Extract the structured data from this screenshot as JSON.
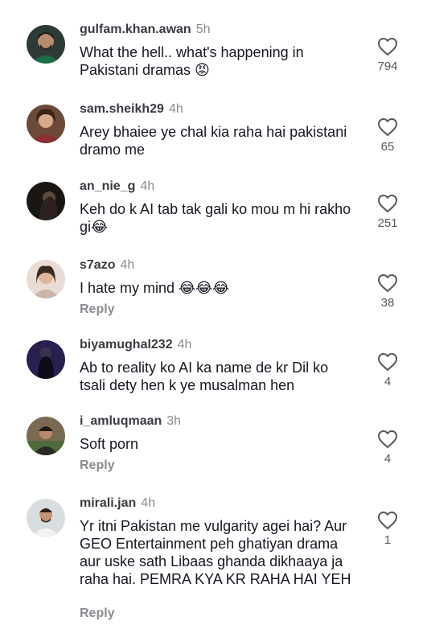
{
  "comments": [
    {
      "username": "gulfam.khan.awan",
      "time": "5h",
      "text": "What the hell.. what's happening in Pakistani dramas 😡",
      "likes": "794",
      "reply": ""
    },
    {
      "username": "sam.sheikh29",
      "time": "4h",
      "text": "Arey bhaiee ye chal kia raha hai pakistani dramo me",
      "likes": "65",
      "reply": ""
    },
    {
      "username": "an_nie_g",
      "time": "4h",
      "text": "Keh do k AI tab tak gali ko mou m hi rakho gi😂",
      "likes": "251",
      "reply": ""
    },
    {
      "username": "s7azo",
      "time": "4h",
      "text": "I hate my mind 😂😂😂",
      "likes": "38",
      "reply": "Reply"
    },
    {
      "username": "biyamughal232",
      "time": "4h",
      "text": "Ab to reality ko AI ka name  de kr Dil ko tsali dety hen k ye musalman hen",
      "likes": "4",
      "reply": ""
    },
    {
      "username": "i_amluqmaan",
      "time": "3h",
      "text": "Soft porn",
      "likes": "4",
      "reply": "Reply"
    },
    {
      "username": "mirali.jan",
      "time": "4h",
      "text": "Yr itni Pakistan me vulgarity agei hai? Aur GEO Entertainment peh ghatiyan drama aur uske sath Libaas ghanda dikhaaya ja raha hai. PEMRA KYA KR RAHA HAI YEH",
      "likes": "1",
      "reply": "Reply"
    }
  ],
  "icons": {
    "like": "heart-outline-icon"
  },
  "colors": {
    "username": "#3a3b42",
    "meta": "#8a8b91",
    "text": "#161823"
  }
}
